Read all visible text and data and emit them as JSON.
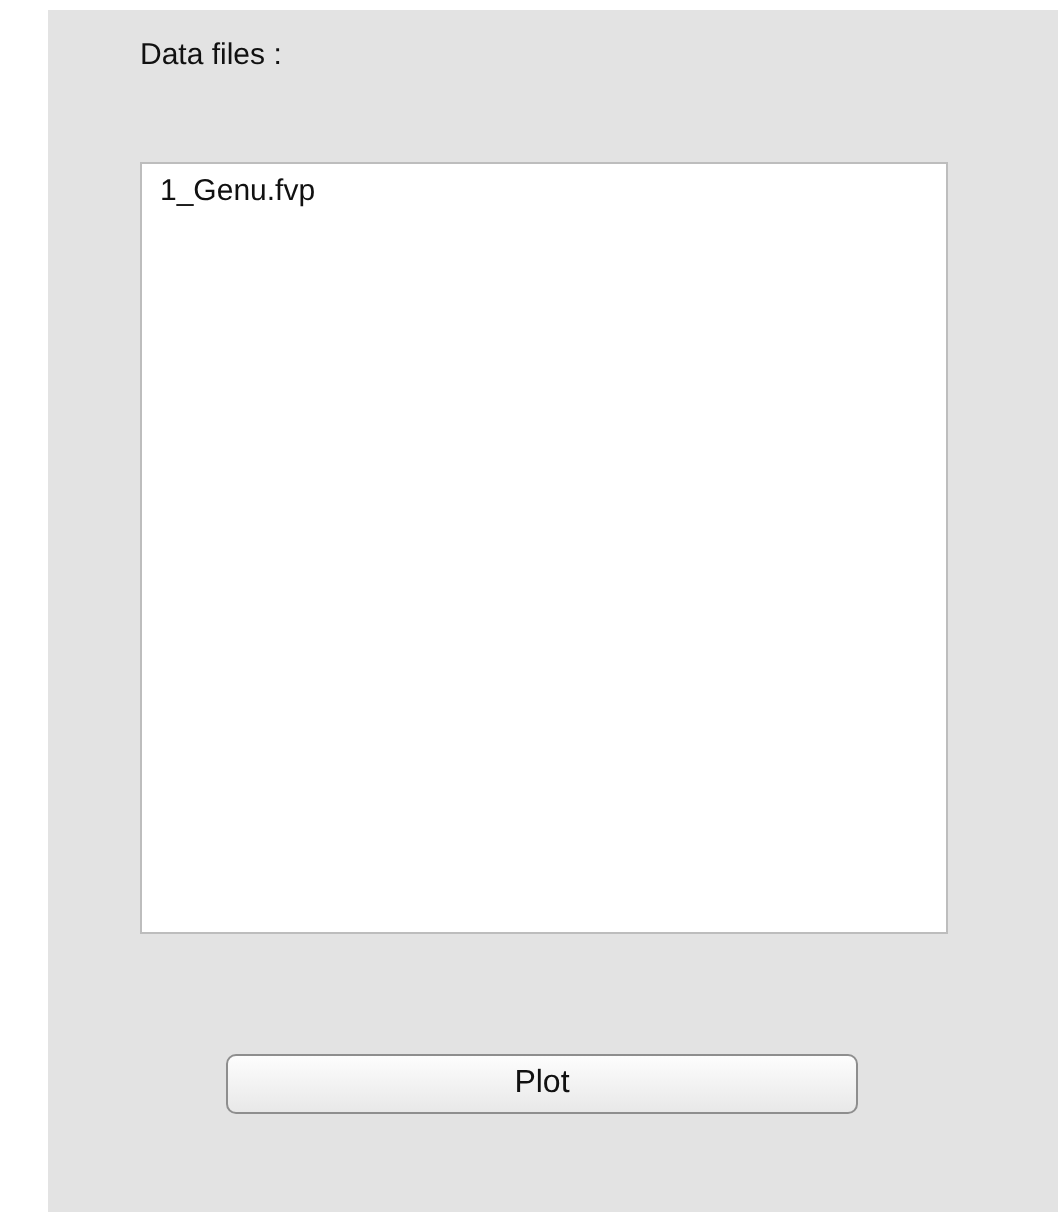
{
  "label": "Data files :",
  "files": [
    {
      "name": "1_Genu.fvp"
    }
  ],
  "buttons": [
    {
      "label": "Plot"
    }
  ]
}
